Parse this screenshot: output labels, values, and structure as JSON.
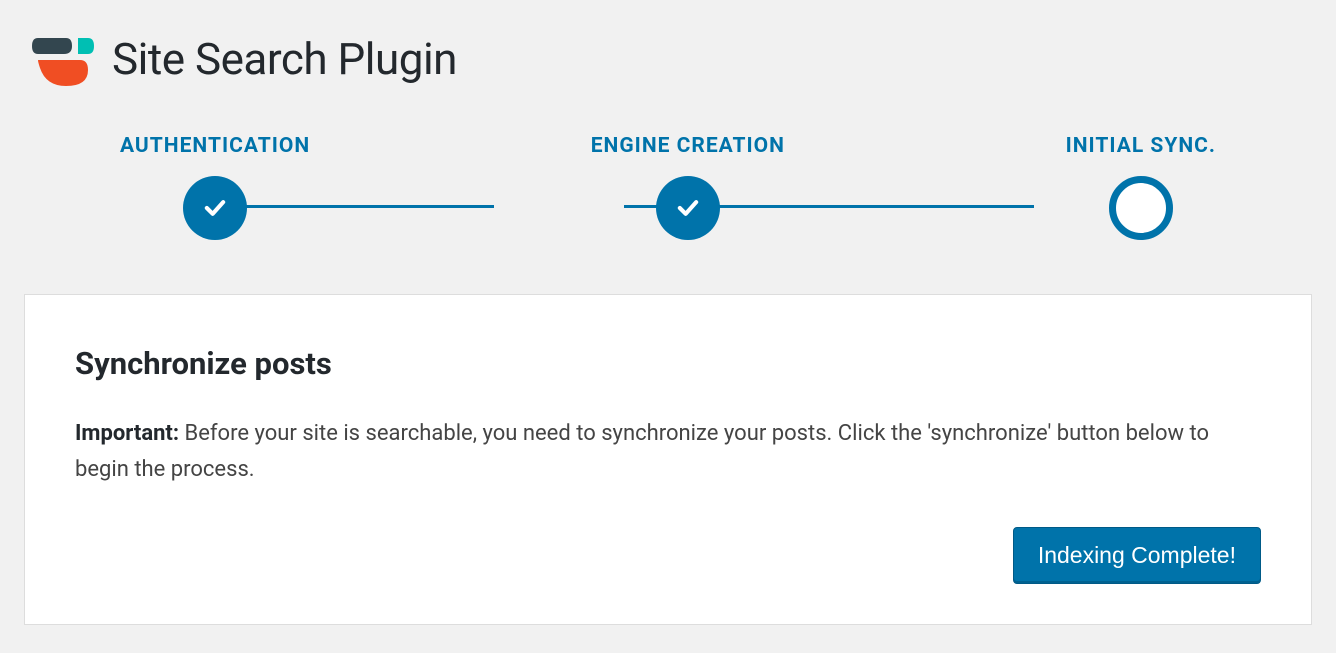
{
  "header": {
    "title": "Site Search Plugin"
  },
  "stepper": {
    "steps": [
      {
        "label": "AUTHENTICATION",
        "state": "done"
      },
      {
        "label": "ENGINE CREATION",
        "state": "done"
      },
      {
        "label": "INITIAL SYNC.",
        "state": "current"
      }
    ]
  },
  "panel": {
    "title": "Synchronize posts",
    "important_label": "Important:",
    "body": " Before your site is searchable, you need to synchronize your posts. Click the 'synchronize' button below to begin the process.",
    "button_label": "Indexing Complete!"
  }
}
